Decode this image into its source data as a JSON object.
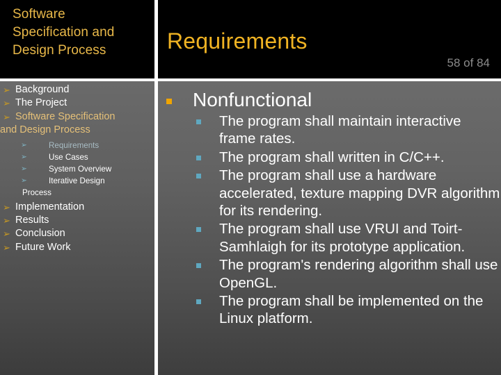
{
  "header": {
    "deck_title_lines": [
      "Software",
      "Specification and",
      "Design Process"
    ],
    "slide_title": "Requirements",
    "page_counter": "58 of 84",
    "title_color": "#f0b323",
    "counter_color": "#8b8b8b",
    "background": "#000000"
  },
  "sidebar": {
    "arrow_icon": "➢",
    "sub_arrow_icon": "➢",
    "arrow_color": "#c99a22",
    "sub_arrow_color": "#7fb4c4",
    "active_color": "#e5c078",
    "items": [
      {
        "label": "Background",
        "level": 1,
        "active": false
      },
      {
        "label": "The Project",
        "level": 1,
        "active": false
      },
      {
        "label": "Software Specification",
        "label2": "and Design Process",
        "level": 1,
        "active": true
      },
      {
        "label": "Requirements",
        "level": 2,
        "active": true
      },
      {
        "label": "Use Cases",
        "level": 2,
        "active": false
      },
      {
        "label": "System Overview",
        "level": 2,
        "active": false
      },
      {
        "label": "Iterative Design",
        "label2": "Process",
        "level": 2,
        "active": false
      },
      {
        "label": "Implementation",
        "level": 1,
        "active": false
      },
      {
        "label": "Results",
        "level": 1,
        "active": false
      },
      {
        "label": "Conclusion",
        "level": 1,
        "active": false
      },
      {
        "label": "Future Work",
        "level": 1,
        "active": false
      }
    ]
  },
  "content": {
    "heading": "Nonfunctional",
    "heading_bullet_color": "#f0a500",
    "bullet_color": "#5fa8c0",
    "bullets": [
      "The program shall maintain interactive frame rates.",
      "The program shall written in C/C++.",
      "The program shall use a hardware accelerated, texture mapping DVR algorithm for its rendering.",
      "The program shall use VRUI and Toirt-Samhlaigh for its prototype application.",
      "The program's rendering algorithm shall use OpenGL.",
      "The program shall be implemented on the Linux platform."
    ]
  }
}
